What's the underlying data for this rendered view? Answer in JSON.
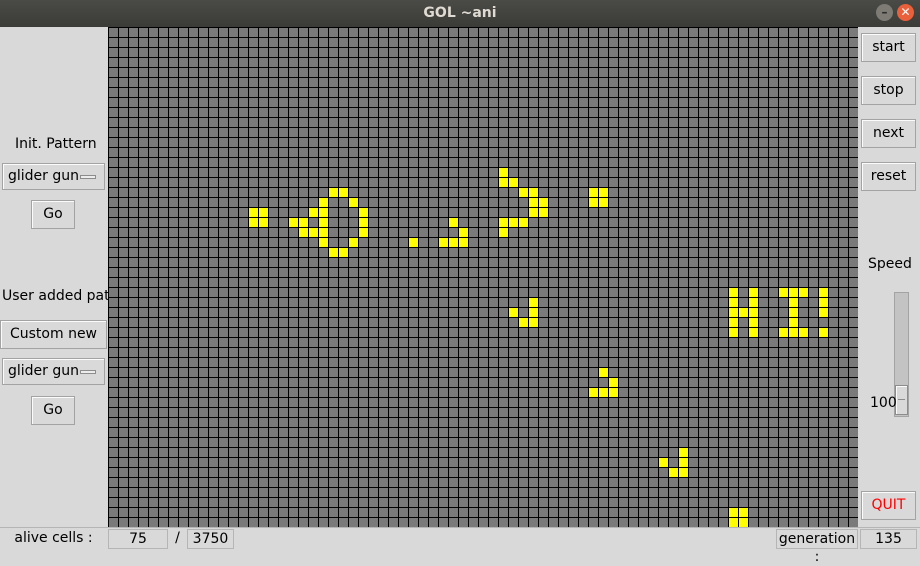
{
  "window": {
    "title": "GOL ~ani",
    "minimize_glyph": "–",
    "close_glyph": "✕"
  },
  "left_panel": {
    "init_label": "Init. Pattern",
    "init_dropdown_value": "glider gun",
    "init_go_label": "Go",
    "user_label": "User added patt",
    "custom_button_label": "Custom new",
    "user_dropdown_value": "glider gun",
    "user_go_label": "Go"
  },
  "right_panel": {
    "start_label": "start",
    "stop_label": "stop",
    "next_label": "next",
    "reset_label": "reset",
    "speed_label": "Speed",
    "speed_value": "100",
    "quit_label": "QUIT"
  },
  "status_bar": {
    "alive_label": "alive cells :",
    "alive_value": "75",
    "separator": "/",
    "total_value": "3750",
    "generation_label": "generation :",
    "generation_value": "135"
  },
  "colors": {
    "alive_cell": "#ffff00",
    "dead_cell": "#7a7a7a",
    "grid_line": "#000000",
    "quit_text": "#ff0000",
    "titlebar": "#3e3e3a",
    "close_button": "#e9603a"
  },
  "grid": {
    "columns": 75,
    "rows": 50,
    "alive_cells": [
      [
        14,
        18
      ],
      [
        15,
        18
      ],
      [
        14,
        19
      ],
      [
        15,
        19
      ],
      [
        18,
        19
      ],
      [
        19,
        19
      ],
      [
        20,
        18
      ],
      [
        21,
        17
      ],
      [
        22,
        16
      ],
      [
        23,
        16
      ],
      [
        24,
        17
      ],
      [
        25,
        18
      ],
      [
        25,
        19
      ],
      [
        25,
        20
      ],
      [
        24,
        21
      ],
      [
        23,
        22
      ],
      [
        22,
        22
      ],
      [
        21,
        21
      ],
      [
        20,
        20
      ],
      [
        21,
        18
      ],
      [
        21,
        19
      ],
      [
        21,
        20
      ],
      [
        19,
        20
      ],
      [
        30,
        21
      ],
      [
        34,
        19
      ],
      [
        35,
        20
      ],
      [
        34,
        21
      ],
      [
        35,
        21
      ],
      [
        33,
        21
      ],
      [
        39,
        14
      ],
      [
        40,
        15
      ],
      [
        39,
        15
      ],
      [
        41,
        16
      ],
      [
        42,
        16
      ],
      [
        42,
        17
      ],
      [
        43,
        17
      ],
      [
        43,
        18
      ],
      [
        42,
        18
      ],
      [
        41,
        19
      ],
      [
        40,
        19
      ],
      [
        39,
        20
      ],
      [
        39,
        19
      ],
      [
        48,
        16
      ],
      [
        49,
        16
      ],
      [
        48,
        17
      ],
      [
        49,
        17
      ],
      [
        42,
        27
      ],
      [
        42,
        28
      ],
      [
        41,
        29
      ],
      [
        40,
        28
      ],
      [
        42,
        29
      ],
      [
        62,
        26
      ],
      [
        62,
        27
      ],
      [
        62,
        28
      ],
      [
        62,
        29
      ],
      [
        62,
        30
      ],
      [
        63,
        28
      ],
      [
        64,
        26
      ],
      [
        64,
        27
      ],
      [
        64,
        28
      ],
      [
        64,
        29
      ],
      [
        64,
        30
      ],
      [
        67,
        26
      ],
      [
        68,
        26
      ],
      [
        69,
        26
      ],
      [
        68,
        27
      ],
      [
        68,
        28
      ],
      [
        68,
        29
      ],
      [
        67,
        30
      ],
      [
        68,
        30
      ],
      [
        69,
        30
      ],
      [
        71,
        26
      ],
      [
        71,
        27
      ],
      [
        71,
        28
      ],
      [
        71,
        30
      ],
      [
        49,
        34
      ],
      [
        50,
        35
      ],
      [
        48,
        36
      ],
      [
        49,
        36
      ],
      [
        50,
        36
      ],
      [
        57,
        42
      ],
      [
        57,
        43
      ],
      [
        56,
        44
      ],
      [
        55,
        43
      ],
      [
        57,
        44
      ],
      [
        62,
        48
      ],
      [
        63,
        48
      ],
      [
        62,
        49
      ],
      [
        63,
        49
      ]
    ]
  }
}
